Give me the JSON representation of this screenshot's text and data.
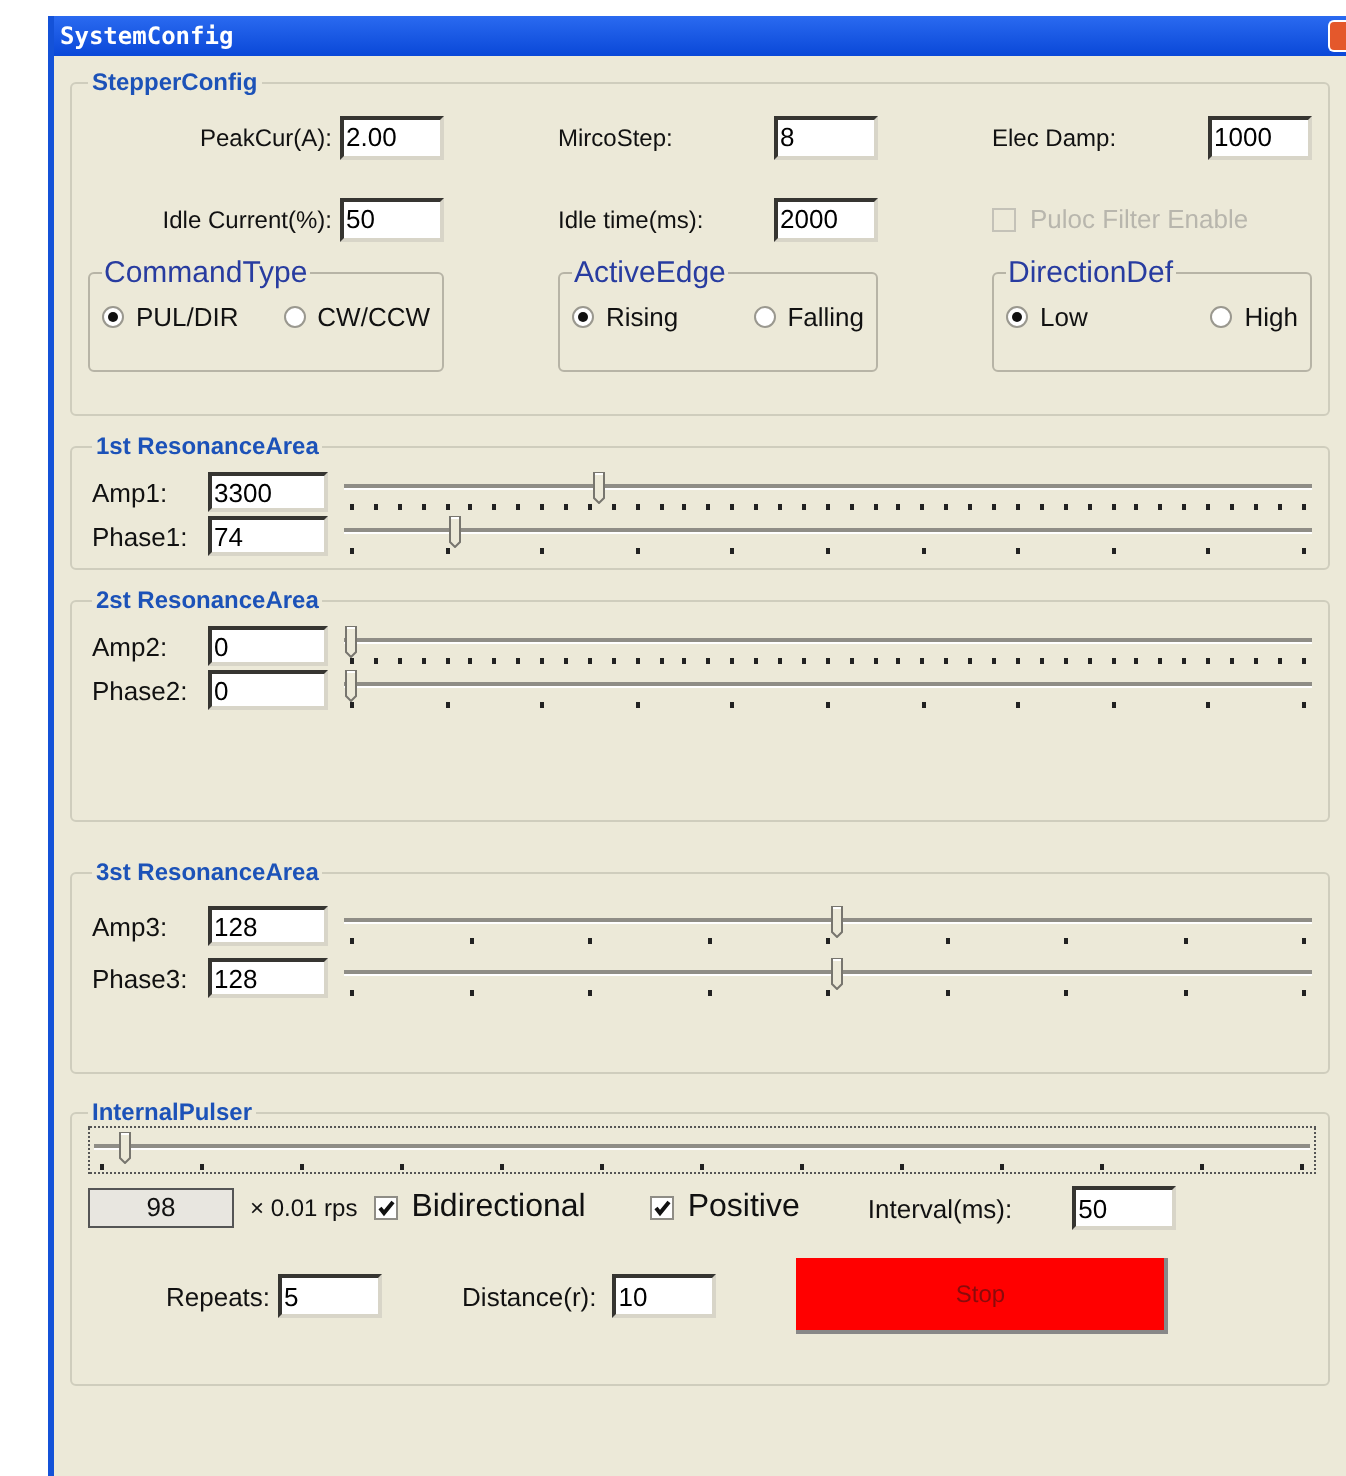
{
  "window": {
    "title": "SystemConfig"
  },
  "stepper_config": {
    "title": "StepperConfig",
    "columns": [
      {
        "items": [
          {
            "kind": "field",
            "label": "PeakCur(A):",
            "value": "2.00"
          },
          {
            "kind": "field",
            "label": "Idle Current(%):",
            "value": "50"
          }
        ],
        "group": {
          "title": "CommandType",
          "options": [
            {
              "label": "PUL/DIR",
              "selected": true
            },
            {
              "label": "CW/CCW",
              "selected": false
            }
          ]
        }
      },
      {
        "items": [
          {
            "kind": "field",
            "label": "MircoStep:",
            "value": "8"
          },
          {
            "kind": "field",
            "label": "Idle time(ms):",
            "value": "2000"
          }
        ],
        "group": {
          "title": "ActiveEdge",
          "options": [
            {
              "label": "Rising",
              "selected": true
            },
            {
              "label": "Falling",
              "selected": false
            }
          ]
        }
      },
      {
        "items": [
          {
            "kind": "field",
            "label": "Elec Damp:",
            "value": "1000"
          },
          {
            "kind": "checkbox",
            "label": "Puloc Filter Enable",
            "checked": false,
            "disabled": true
          }
        ],
        "group": {
          "title": "DirectionDef",
          "options": [
            {
              "label": "Low",
              "selected": true
            },
            {
              "label": "High",
              "selected": false
            }
          ]
        }
      }
    ]
  },
  "resonance_areas": [
    {
      "title": "1st ResonanceArea",
      "rows": [
        {
          "label": "Amp1:",
          "value": "3300",
          "level": 0.26,
          "kind": "fine"
        },
        {
          "label": "Phase1:",
          "value": "74",
          "level": 0.11,
          "kind": "coarse"
        }
      ]
    },
    {
      "title": "2st ResonanceArea",
      "rows": [
        {
          "label": "Amp2:",
          "value": "0",
          "level": 0,
          "kind": "fine"
        },
        {
          "label": "Phase2:",
          "value": "0",
          "level": 0,
          "kind": "coarse"
        }
      ]
    },
    {
      "title": "3st ResonanceArea",
      "rows": [
        {
          "label": "Amp3:",
          "value": "128",
          "level": 0.51,
          "kind": "sparse"
        },
        {
          "label": "Phase3:",
          "value": "128",
          "level": 0.51,
          "kind": "sparse"
        }
      ]
    }
  ],
  "internal_pulser": {
    "title": "InternalPulser",
    "slider": {
      "level": 0.02,
      "kind": "medium"
    },
    "speed": {
      "value": "98",
      "unit": "× 0.01 rps"
    },
    "checkboxes": [
      {
        "label": "Bidirectional",
        "checked": true
      },
      {
        "label": "Positive",
        "checked": true
      }
    ],
    "interval": {
      "label": "Interval(ms):",
      "value": "50"
    },
    "repeats": {
      "label": "Repeats:",
      "value": "5"
    },
    "distance": {
      "label": "Distance(r):",
      "value": "10"
    },
    "stop_button": {
      "label": "Stop"
    }
  }
}
